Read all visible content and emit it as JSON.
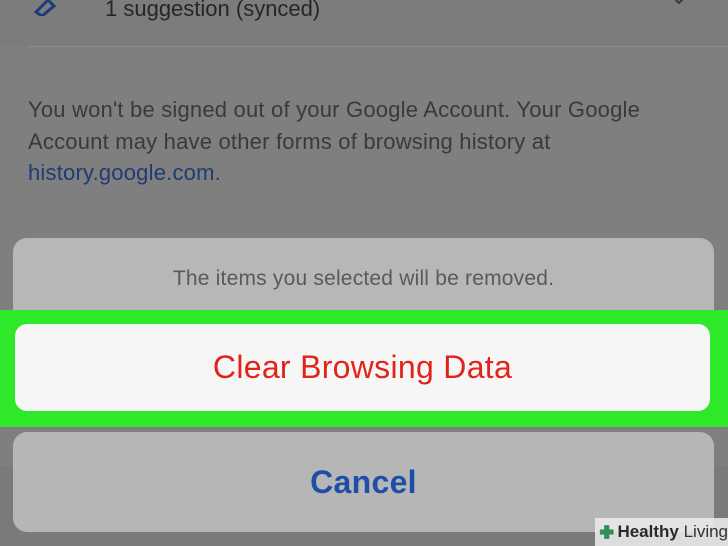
{
  "background": {
    "suggestion_text": "1 suggestion (synced)",
    "info_text": "You won't be signed out of your Google Account. Your Google Account may have other forms of browsing history at",
    "info_link": "history.google.com",
    "info_period": "."
  },
  "action_sheet": {
    "message": "The items you selected will be removed.",
    "clear_label": "Clear Browsing Data",
    "cancel_label": "Cancel"
  },
  "watermark": {
    "brand_bold": "Healthy",
    "brand_rest": " Living"
  },
  "colors": {
    "highlight": "#2ee82a",
    "destructive": "#e2231a",
    "cancel": "#1e4fa8",
    "link": "#1f3b76"
  }
}
